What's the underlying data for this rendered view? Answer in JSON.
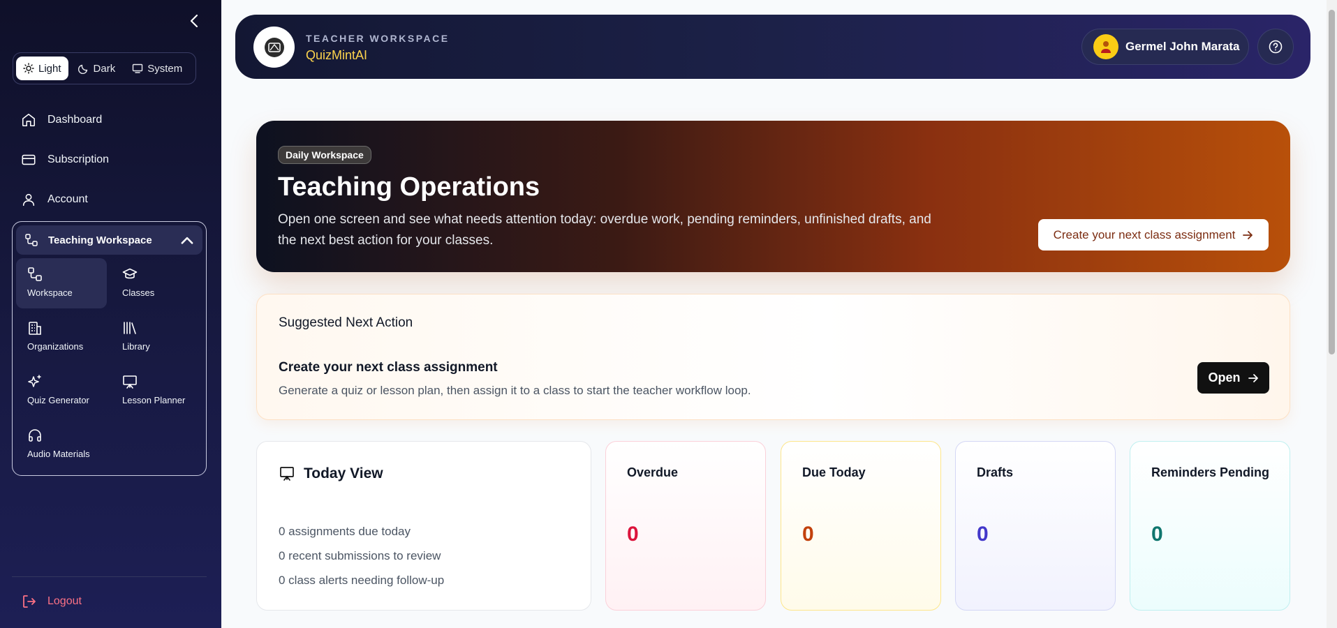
{
  "sidebar": {
    "theme": {
      "light": "Light",
      "dark": "Dark",
      "system": "System"
    },
    "nav": {
      "dashboard": "Dashboard",
      "subscription": "Subscription",
      "account": "Account"
    },
    "workspace_header": "Teaching Workspace",
    "workspace_items": {
      "workspace": "Workspace",
      "classes": "Classes",
      "organizations": "Organizations",
      "library": "Library",
      "quiz_generator": "Quiz Generator",
      "lesson_planner": "Lesson Planner",
      "audio_materials": "Audio Materials"
    },
    "logout": "Logout"
  },
  "topbar": {
    "subtitle": "TEACHER WORKSPACE",
    "title": "QuizMintAI",
    "user_name": "Germel John Marata"
  },
  "hero": {
    "badge": "Daily Workspace",
    "title": "Teaching Operations",
    "description": "Open one screen and see what needs attention today: overdue work, pending reminders, unfinished drafts, and the next best action for your classes.",
    "cta": "Create your next class assignment"
  },
  "suggestion": {
    "section_title": "Suggested Next Action",
    "title": "Create your next class assignment",
    "description": "Generate a quiz or lesson plan, then assign it to a class to start the teacher workflow loop.",
    "button": "Open"
  },
  "today": {
    "title": "Today View",
    "lines": [
      "0 assignments due today",
      "0 recent submissions to review",
      "0 class alerts needing follow-up"
    ]
  },
  "stats": [
    {
      "label": "Overdue",
      "value": "0",
      "color": "#dc143c"
    },
    {
      "label": "Due Today",
      "value": "0",
      "color": "#c2410c"
    },
    {
      "label": "Drafts",
      "value": "0",
      "color": "#4338ca"
    },
    {
      "label": "Reminders Pending",
      "value": "0",
      "color": "#0f766e"
    }
  ],
  "colors": {
    "accent_logout": "#fb7185",
    "brand_yellow": "#fcd34d"
  }
}
